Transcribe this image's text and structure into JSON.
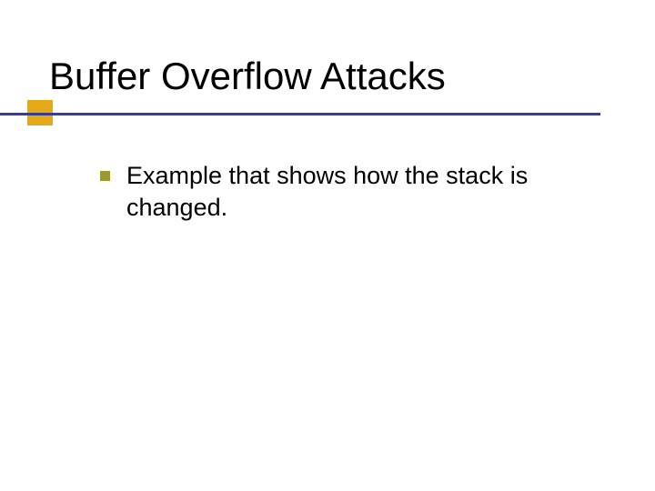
{
  "title": "Buffer Overflow Attacks",
  "bullets": [
    {
      "text": "Example that shows how the stack is changed."
    }
  ],
  "colors": {
    "accent_line": "#3c3c8c",
    "accent_box": "#e0a000",
    "bullet": "#9a9a33"
  }
}
